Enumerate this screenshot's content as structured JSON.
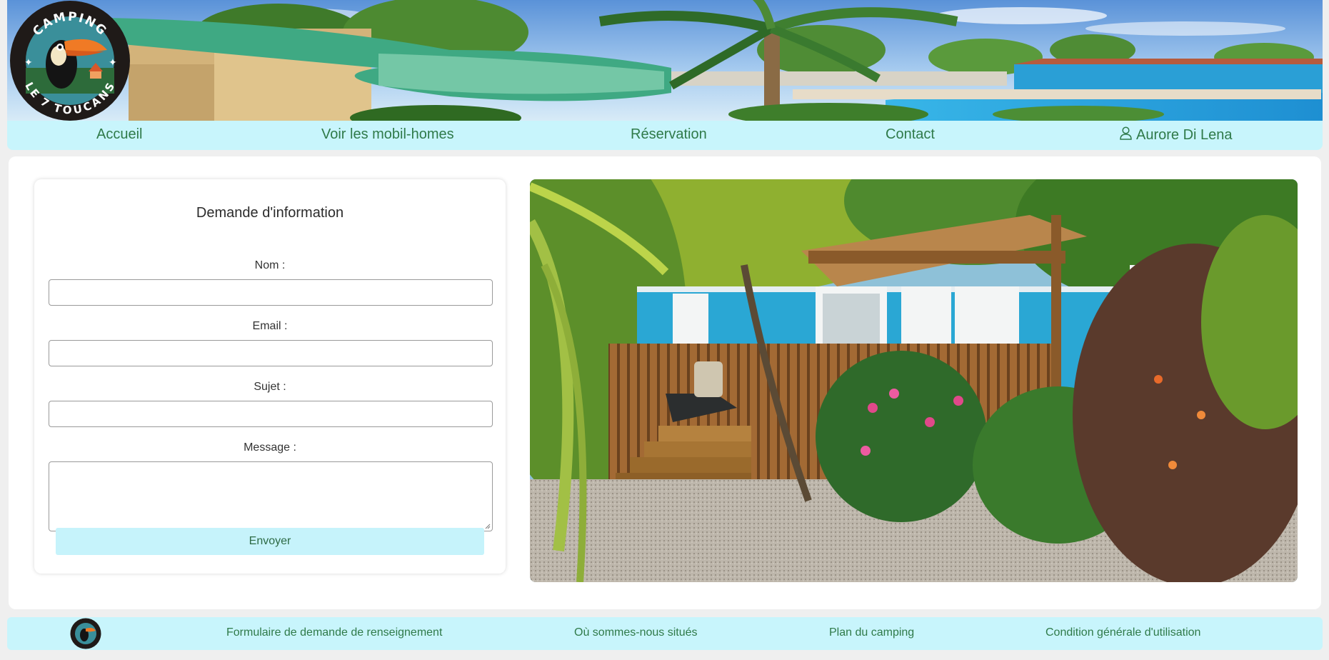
{
  "brand": {
    "logo_text_top": "CAMPING",
    "logo_text_bottom": "LE 7 TOUCANS"
  },
  "nav": {
    "items": [
      {
        "label": "Accueil"
      },
      {
        "label": "Voir les mobil-homes"
      },
      {
        "label": "Réservation"
      },
      {
        "label": "Contact"
      }
    ],
    "user_name": "Aurore Di Lena"
  },
  "form": {
    "title": "Demande d'information",
    "fields": [
      {
        "label": "Nom :",
        "value": "",
        "placeholder": ""
      },
      {
        "label": "Email :",
        "value": "",
        "placeholder": ""
      },
      {
        "label": "Sujet :",
        "value": "",
        "placeholder": ""
      }
    ],
    "message_label": "Message :",
    "message_value": "",
    "submit_label": "Envoyer"
  },
  "footer": {
    "links": [
      {
        "label": "Formulaire de demande de renseignement"
      },
      {
        "label": "Où sommes-nous situés"
      },
      {
        "label": "Plan du camping"
      },
      {
        "label": "Condition générale d'utilisation"
      }
    ]
  },
  "colors": {
    "nav_background": "#c8f5fc",
    "link_green": "#2f7a49",
    "page_background": "#efefef",
    "button_background": "#c6f3fb"
  }
}
